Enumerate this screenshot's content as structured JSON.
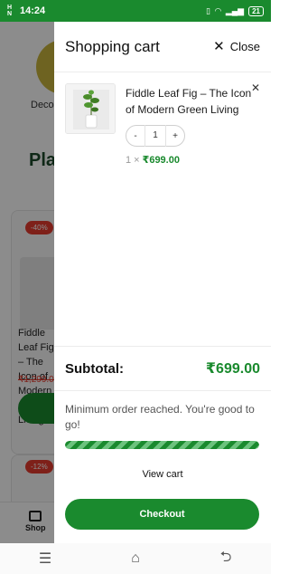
{
  "status_bar": {
    "sim_label": "H\nN",
    "time": "14:24",
    "battery": "21"
  },
  "background": {
    "category_label": "Deco",
    "section_title": "Pla",
    "badge1": "-40%",
    "badge2": "-12%",
    "product_name": "Fiddle Leaf Fig – The Icon of Modern Green Living",
    "product_old_price": "₹1,299.00",
    "nav_shop_label": "Shop"
  },
  "cart": {
    "title": "Shopping cart",
    "close_label": "Close",
    "items": [
      {
        "name": "Fiddle Leaf Fig – The Icon of Modern Green Living",
        "qty_minus": "-",
        "qty_value": "1",
        "qty_plus": "+",
        "qty_prefix": "1 ×",
        "price": "₹699.00"
      }
    ],
    "subtotal_label": "Subtotal:",
    "subtotal_value": "₹699.00",
    "min_order_message": "Minimum order reached. You're good to go!",
    "progress_fraction": 1.0,
    "view_cart_label": "View cart",
    "checkout_label": "Checkout"
  },
  "colors": {
    "brand_green": "#1a8a2e",
    "sale_red": "#e63b2e"
  },
  "icons": {
    "close": "close-icon",
    "remove": "remove-item-icon",
    "nav_menu": "menu-lines-icon",
    "nav_home": "home-icon",
    "nav_back": "back-icon",
    "shop": "shop-icon"
  }
}
